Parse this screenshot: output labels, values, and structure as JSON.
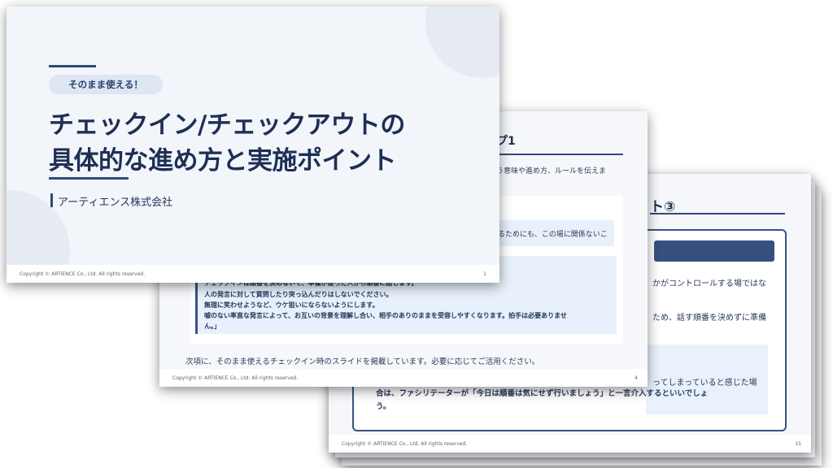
{
  "slide_front": {
    "badge": "そのまま使える！",
    "title_line1": "チェックイン/チェックアウトの",
    "title_line2": "具体的な進め方と実施ポイント",
    "company": "アーティエンス株式会社",
    "copyright": "Copyright © ARTIENCE Co., Ltd. All rights reserved.",
    "page": "1"
  },
  "slide_middle": {
    "heading": "プ1",
    "intro": "う意味や進め方、ルールを伝えま",
    "note": "るためにも、この場に関係ないこ",
    "quote_lines": [
      "チェックインは順番を決めないで、準備が整った人から順番に話します。",
      "人の発言に対して質問したり突っ込んだりはしないでください。",
      "無理に笑わせようなど、ウケ狙いにならないようにします。",
      "嘘のない率直な発言によって、お互いの背景を理解し合い、相手のありのままを受容しやすくなります。拍手は必要ありませ",
      "ん。」"
    ],
    "next_text": "次項に、そのまま使えるチェックイン時のスライドを掲載しています。必要に応じてご活用ください。",
    "copyright": "Copyright © ARTIENCE Co., Ltd. All rights reserved.",
    "page": "4"
  },
  "slide_back": {
    "heading": "ト③",
    "line1": "かがコントロールする場ではな",
    "line2": "ため、話す順番を決めずに準備",
    "line3": "ってしまっていると感じた場",
    "line4": "合は、ファシリテーターが「今日は順番は気にせず行いましょう」と一言介入するといいでしょ",
    "line5": "う。",
    "copyright": "Copyright © ARTIENCE Co., Ltd. All rights reserved.",
    "page": "15"
  }
}
